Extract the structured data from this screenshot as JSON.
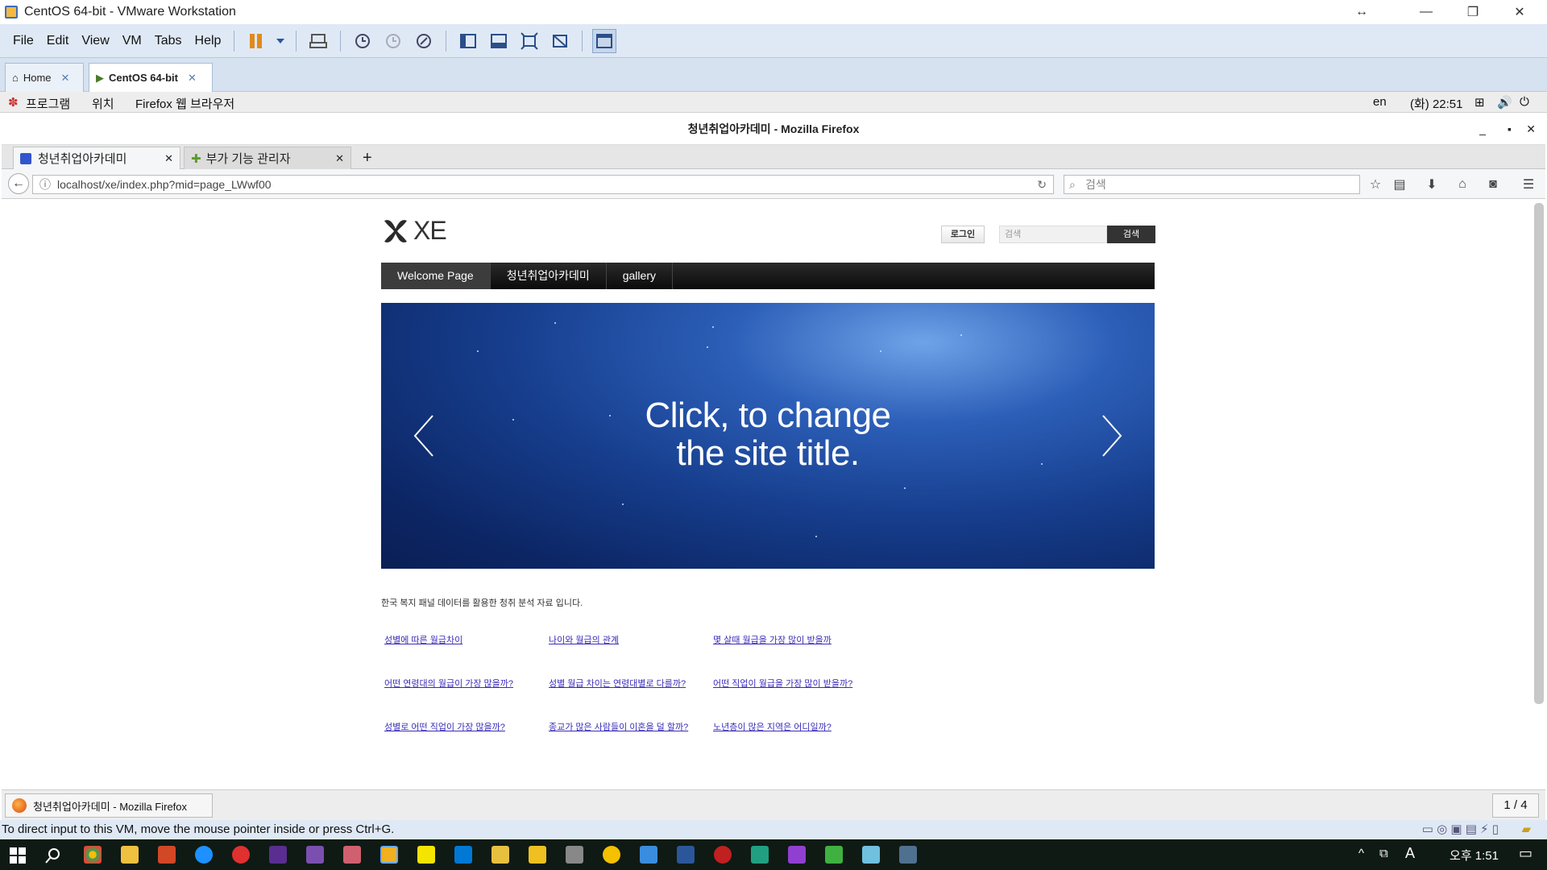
{
  "vmware": {
    "title": "CentOS 64-bit - VMware Workstation",
    "menus": [
      "File",
      "Edit",
      "View",
      "VM",
      "Tabs",
      "Help"
    ],
    "tabs": [
      {
        "label": "Home"
      },
      {
        "label": "CentOS 64-bit"
      }
    ],
    "status": "To direct input to this VM, move the mouse pointer inside or press Ctrl+G."
  },
  "gnome": {
    "apps": "프로그램",
    "places": "위치",
    "browser": "Firefox 웹 브라우저",
    "lang": "en",
    "datetime": "(화) 22:51",
    "task": "청년취업아카데미 - Mozilla Firefox",
    "pager": "1 / 4"
  },
  "firefox": {
    "title": "청년취업아카데미 - Mozilla Firefox",
    "tabs": [
      {
        "label": "청년취업아카데미"
      },
      {
        "label": "부가 기능 관리자"
      }
    ],
    "url": "localhost/xe/index.php?mid=page_LWwf00",
    "search_placeholder": "검색"
  },
  "page": {
    "logo": "XE",
    "login": "로그인",
    "search_placeholder": "검색",
    "search_button": "검색",
    "nav": [
      "Welcome Page",
      "청년취업아카데미",
      "gallery"
    ],
    "hero_line1": "Click, to change",
    "hero_line2": "the site title.",
    "intro": "한국 복지 패널 데이터를 활용한 청취 분석 자료 입니다.",
    "links": [
      [
        "성별에 따른 월급차이",
        "나이와 월급의 관계",
        "몇 살때 월급을 가장 많이 받을까"
      ],
      [
        "어떤 연령대의 월급이 가장 많을까?",
        "성별 월급 차이는 연령대별로 다를까?",
        "어떤 직업이 월급을 가장 많이 받을까?"
      ],
      [
        "성별로 어떤 직업이 가장 많을까?",
        "종교가 많은 사람들이 이혼을 덜 할까?",
        "노년층이 많은 지역은 어디일까?"
      ]
    ]
  },
  "windows": {
    "clock": "오후 1:51",
    "tray_letter": "A"
  }
}
